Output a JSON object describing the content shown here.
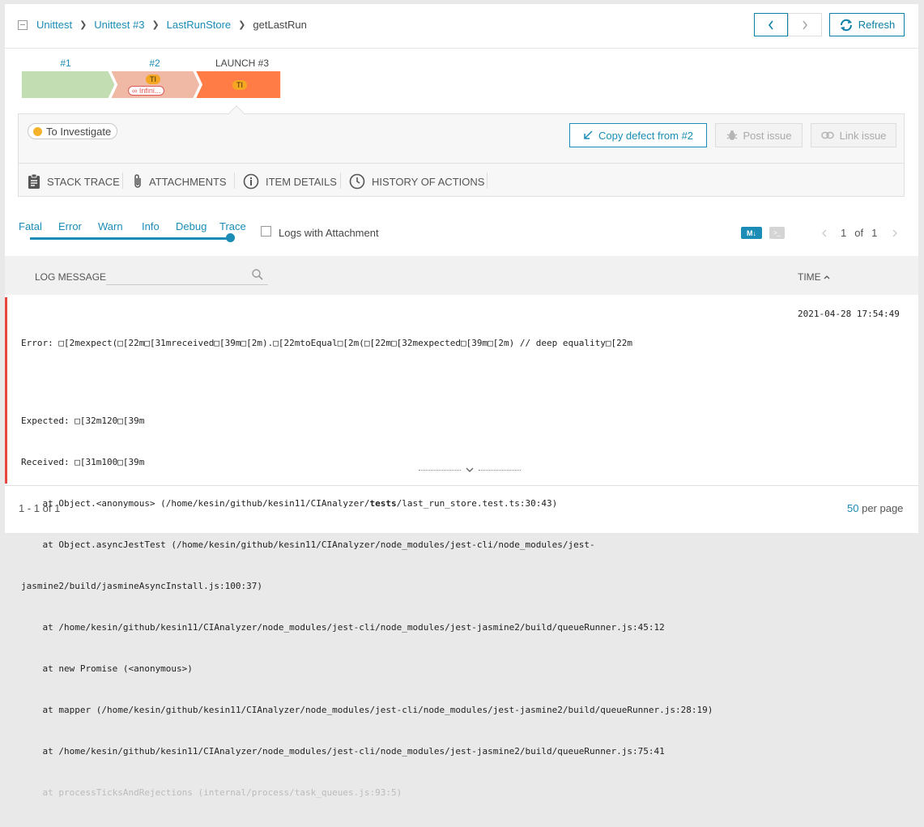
{
  "breadcrumb": {
    "items": [
      "Unittest",
      "Unittest #3",
      "LastRunStore"
    ],
    "current": "getLastRun"
  },
  "header": {
    "refresh_label": "Refresh"
  },
  "history": {
    "launches": [
      {
        "label": "#1",
        "status": "passed",
        "color": "#c2ddb2"
      },
      {
        "label": "#2",
        "status": "failed",
        "color": "#f0b9a6",
        "badge": "TI",
        "extra": "∞ Infini..."
      },
      {
        "label": "LAUNCH #3",
        "status": "failed",
        "color": "#ff7c46",
        "badge": "TI"
      }
    ]
  },
  "defect": {
    "badge_label": "To Investigate",
    "copy_label": "Copy defect from #2",
    "post_label": "Post issue",
    "link_label": "Link issue"
  },
  "tabs": [
    {
      "label": "STACK TRACE",
      "icon": "clipboard-icon"
    },
    {
      "label": "ATTACHMENTS",
      "icon": "paperclip-icon"
    },
    {
      "label": "ITEM DETAILS",
      "icon": "info-icon"
    },
    {
      "label": "HISTORY OF ACTIONS",
      "icon": "clock-icon"
    }
  ],
  "log_levels": [
    "Fatal",
    "Error",
    "Warn",
    "Info",
    "Debug",
    "Trace"
  ],
  "logs_with_attachment_label": "Logs with Attachment",
  "markdown_label": "M↓",
  "console_label": ">_",
  "pager": {
    "current": "1",
    "of_label": "of",
    "total": "1"
  },
  "table": {
    "col_message": "LOG MESSAGE",
    "col_time": "TIME"
  },
  "log_entry": {
    "time": "2021-04-28 17:54:49",
    "line1": "Error: □[2mexpect(□[22m□[31mreceived□[39m□[2m).□[22mtoEqual□[2m(□[22m□[32mexpected□[39m□[2m) // deep equality□[22m",
    "line2": "Expected: □[32m120□[39m",
    "line3": "Received: □[31m100□[39m",
    "line4_a": "    at Object.<anonymous> (/home/kesin/github/kesin11/CIAnalyzer/",
    "line4_b": "tests",
    "line4_c": "/last_run_store.test.ts:30:43)",
    "line5": "    at Object.asyncJestTest (/home/kesin/github/kesin11/CIAnalyzer/node_modules/jest-cli/node_modules/jest-",
    "line6": "jasmine2/build/jasmineAsyncInstall.js:100:37)",
    "line7": "    at /home/kesin/github/kesin11/CIAnalyzer/node_modules/jest-cli/node_modules/jest-jasmine2/build/queueRunner.js:45:12",
    "line8": "    at new Promise (<anonymous>)",
    "line9": "    at mapper (/home/kesin/github/kesin11/CIAnalyzer/node_modules/jest-cli/node_modules/jest-jasmine2/build/queueRunner.js:28:19)",
    "line10": "    at /home/kesin/github/kesin11/CIAnalyzer/node_modules/jest-cli/node_modules/jest-jasmine2/build/queueRunner.js:75:41",
    "line11": "    at processTicksAndRejections (internal/process/task_queues.js:93:5)"
  },
  "footer": {
    "range": "1 - 1 of 1",
    "per_page_value": "50",
    "per_page_label": "per page"
  },
  "colors": {
    "accent": "#1a8cb5",
    "error_stripe": "#e8453c",
    "to_investigate": "#f7b22b"
  }
}
